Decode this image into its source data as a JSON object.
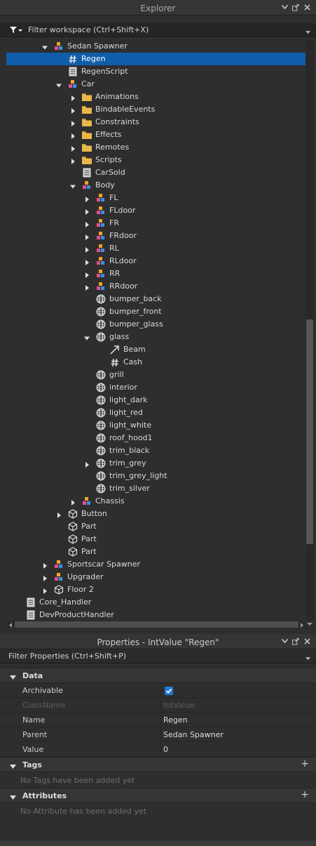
{
  "explorer": {
    "title": "Explorer",
    "filter_placeholder": "Filter workspace (Ctrl+Shift+X)"
  },
  "tree": [
    {
      "label": "Sedan Spawner",
      "depth": 5,
      "arrow": "down",
      "icon": "model"
    },
    {
      "label": "Regen",
      "depth": 6,
      "arrow": "none",
      "icon": "value",
      "selected": true
    },
    {
      "label": "RegenScript",
      "depth": 6,
      "arrow": "none",
      "icon": "script"
    },
    {
      "label": "Car",
      "depth": 6,
      "arrow": "down",
      "icon": "model"
    },
    {
      "label": "Animations",
      "depth": 7,
      "arrow": "right",
      "icon": "folder"
    },
    {
      "label": "BindableEvents",
      "depth": 7,
      "arrow": "right",
      "icon": "folder"
    },
    {
      "label": "Constraints",
      "depth": 7,
      "arrow": "right",
      "icon": "folder"
    },
    {
      "label": "Effects",
      "depth": 7,
      "arrow": "right",
      "icon": "folder"
    },
    {
      "label": "Remotes",
      "depth": 7,
      "arrow": "right",
      "icon": "folder"
    },
    {
      "label": "Scripts",
      "depth": 7,
      "arrow": "right",
      "icon": "folder"
    },
    {
      "label": "CarSold",
      "depth": 7,
      "arrow": "none",
      "icon": "script"
    },
    {
      "label": "Body",
      "depth": 7,
      "arrow": "down",
      "icon": "model"
    },
    {
      "label": "FL",
      "depth": 8,
      "arrow": "right",
      "icon": "model"
    },
    {
      "label": "FLdoor",
      "depth": 8,
      "arrow": "right",
      "icon": "model"
    },
    {
      "label": "FR",
      "depth": 8,
      "arrow": "right",
      "icon": "model"
    },
    {
      "label": "FRdoor",
      "depth": 8,
      "arrow": "right",
      "icon": "model"
    },
    {
      "label": "RL",
      "depth": 8,
      "arrow": "right",
      "icon": "model"
    },
    {
      "label": "RLdoor",
      "depth": 8,
      "arrow": "right",
      "icon": "model"
    },
    {
      "label": "RR",
      "depth": 8,
      "arrow": "right",
      "icon": "model"
    },
    {
      "label": "RRdoor",
      "depth": 8,
      "arrow": "right",
      "icon": "model"
    },
    {
      "label": "bumper_back",
      "depth": 8,
      "arrow": "none",
      "icon": "mesh"
    },
    {
      "label": "bumper_front",
      "depth": 8,
      "arrow": "none",
      "icon": "mesh"
    },
    {
      "label": "bumper_glass",
      "depth": 8,
      "arrow": "none",
      "icon": "mesh"
    },
    {
      "label": "glass",
      "depth": 8,
      "arrow": "down",
      "icon": "mesh"
    },
    {
      "label": "Beam",
      "depth": 9,
      "arrow": "none",
      "icon": "beam"
    },
    {
      "label": "Cash",
      "depth": 9,
      "arrow": "none",
      "icon": "value"
    },
    {
      "label": "grill",
      "depth": 8,
      "arrow": "none",
      "icon": "mesh"
    },
    {
      "label": "interior",
      "depth": 8,
      "arrow": "none",
      "icon": "mesh"
    },
    {
      "label": "light_dark",
      "depth": 8,
      "arrow": "none",
      "icon": "mesh"
    },
    {
      "label": "light_red",
      "depth": 8,
      "arrow": "none",
      "icon": "mesh"
    },
    {
      "label": "light_white",
      "depth": 8,
      "arrow": "none",
      "icon": "mesh"
    },
    {
      "label": "roof_hood1",
      "depth": 8,
      "arrow": "none",
      "icon": "mesh"
    },
    {
      "label": "trim_black",
      "depth": 8,
      "arrow": "none",
      "icon": "mesh"
    },
    {
      "label": "trim_grey",
      "depth": 8,
      "arrow": "right",
      "icon": "mesh"
    },
    {
      "label": "trim_grey_light",
      "depth": 8,
      "arrow": "none",
      "icon": "mesh"
    },
    {
      "label": "trim_silver",
      "depth": 8,
      "arrow": "none",
      "icon": "mesh"
    },
    {
      "label": "Chassis",
      "depth": 7,
      "arrow": "right",
      "icon": "model"
    },
    {
      "label": "Button",
      "depth": 6,
      "arrow": "right",
      "icon": "part"
    },
    {
      "label": "Part",
      "depth": 6,
      "arrow": "none",
      "icon": "part"
    },
    {
      "label": "Part",
      "depth": 6,
      "arrow": "none",
      "icon": "part"
    },
    {
      "label": "Part",
      "depth": 6,
      "arrow": "none",
      "icon": "part"
    },
    {
      "label": "Sportscar Spawner",
      "depth": 5,
      "arrow": "right",
      "icon": "model"
    },
    {
      "label": "Upgrader",
      "depth": 5,
      "arrow": "right",
      "icon": "model"
    },
    {
      "label": "Floor 2",
      "depth": 5,
      "arrow": "right",
      "icon": "part"
    },
    {
      "label": "Core_Handler",
      "depth": 3,
      "arrow": "none",
      "icon": "script"
    },
    {
      "label": "DevProductHandler",
      "depth": 3,
      "arrow": "none",
      "icon": "script"
    }
  ],
  "properties": {
    "title": "Properties - IntValue \"Regen\"",
    "filter_placeholder": "Filter Properties (Ctrl+Shift+P)",
    "data_section": "Data",
    "rows": [
      {
        "name": "Archivable",
        "value": "",
        "type": "checkbox",
        "checked": true,
        "disabled": false
      },
      {
        "name": "ClassName",
        "value": "IntValue",
        "type": "text",
        "disabled": true
      },
      {
        "name": "Name",
        "value": "Regen",
        "type": "text",
        "disabled": false
      },
      {
        "name": "Parent",
        "value": "Sedan Spawner",
        "type": "text",
        "disabled": false
      },
      {
        "name": "Value",
        "value": "0",
        "type": "text",
        "disabled": false
      }
    ],
    "tags_section": "Tags",
    "tags_empty": "No Tags have been added yet",
    "attributes_section": "Attributes",
    "attributes_empty": "No Attribute has been added yet"
  },
  "colors": {
    "selection": "#0f5eaa",
    "folder": "#e8b84a",
    "checkbox": "#1e7ad6",
    "model_orange": "#f0a22a",
    "model_pink": "#e0508c",
    "model_blue": "#3a8ee6"
  }
}
